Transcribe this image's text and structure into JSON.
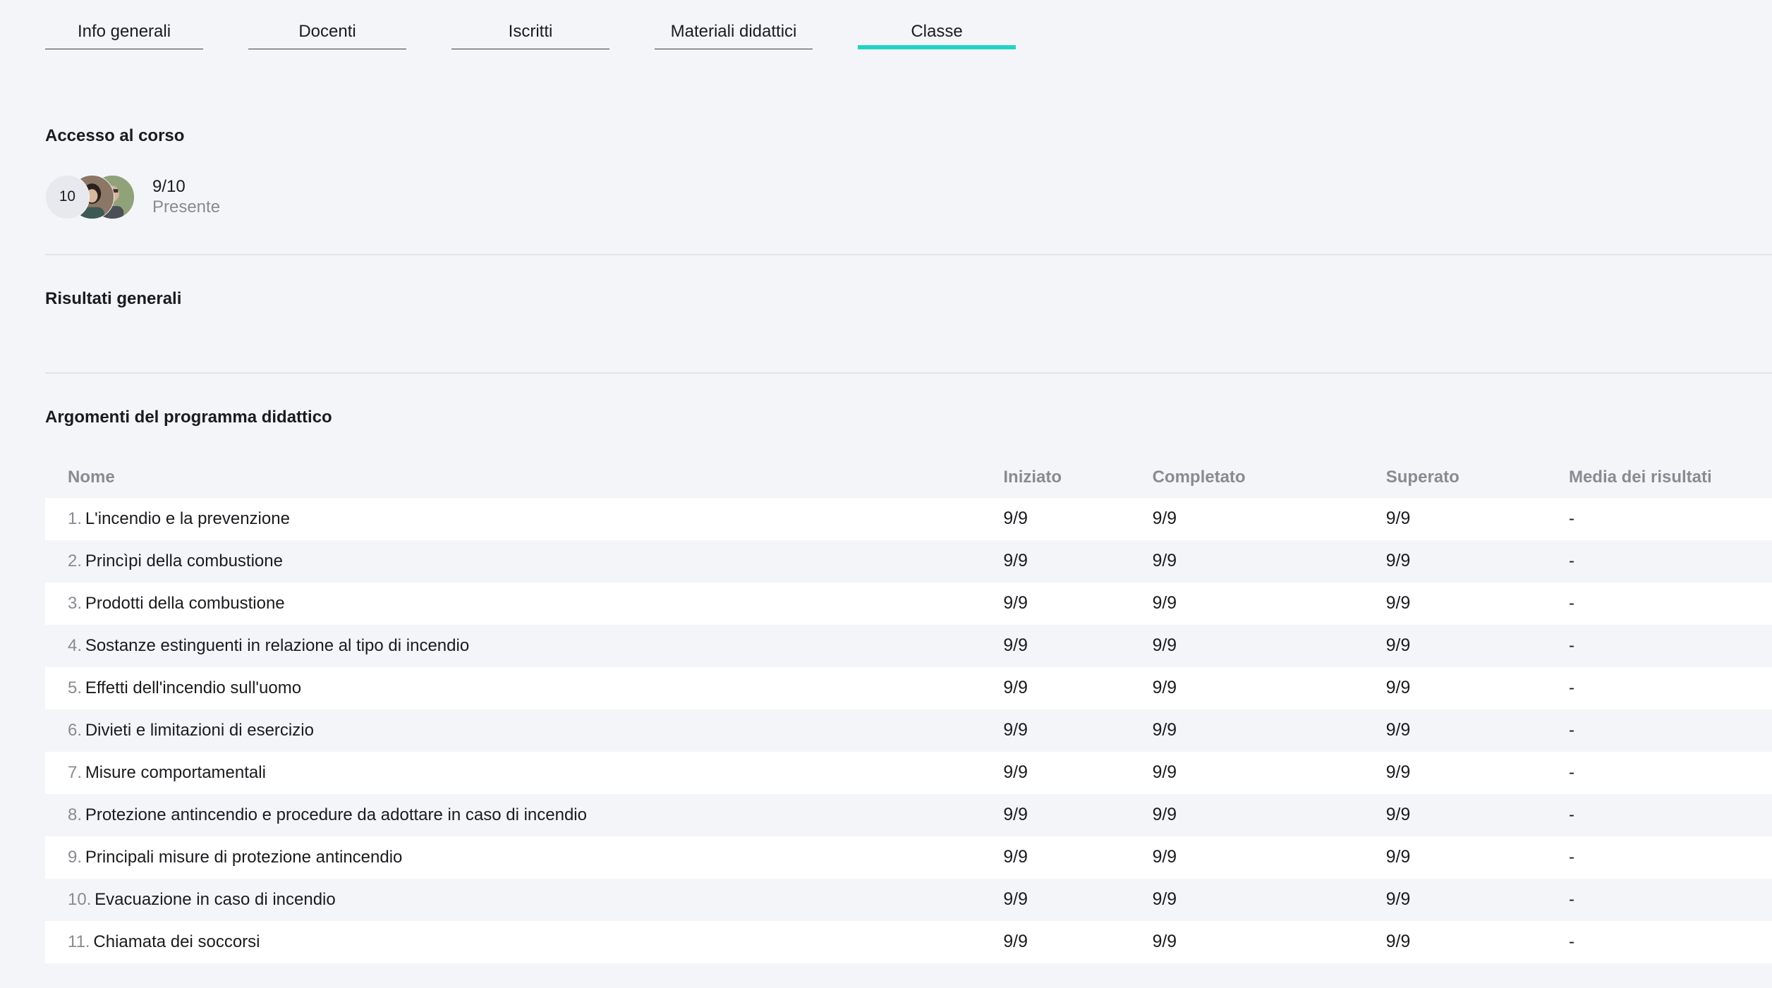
{
  "tabs": [
    {
      "label": "Info generali",
      "active": false
    },
    {
      "label": "Docenti",
      "active": false
    },
    {
      "label": "Iscritti",
      "active": false
    },
    {
      "label": "Materiali didattici",
      "active": false
    },
    {
      "label": "Classe",
      "active": true
    }
  ],
  "accent_color": "#22d3c5",
  "access": {
    "title": "Accesso al corso",
    "avatar_count": "10",
    "ratio": "9/10",
    "status": "Presente"
  },
  "results": {
    "title": "Risultati generali"
  },
  "topics": {
    "title": "Argomenti del programma didattico",
    "columns": {
      "name": "Nome",
      "started": "Iniziato",
      "completed": "Completato",
      "passed": "Superato",
      "average": "Media dei risultati"
    },
    "rows": [
      {
        "index": "1.",
        "name": "L'incendio e la prevenzione",
        "started": "9/9",
        "completed": "9/9",
        "passed": "9/9",
        "average": "-"
      },
      {
        "index": "2.",
        "name": "Princìpi della combustione",
        "started": "9/9",
        "completed": "9/9",
        "passed": "9/9",
        "average": "-"
      },
      {
        "index": "3.",
        "name": "Prodotti della combustione",
        "started": "9/9",
        "completed": "9/9",
        "passed": "9/9",
        "average": "-"
      },
      {
        "index": "4.",
        "name": "Sostanze estinguenti in relazione al tipo di incendio",
        "started": "9/9",
        "completed": "9/9",
        "passed": "9/9",
        "average": "-"
      },
      {
        "index": "5.",
        "name": "Effetti dell'incendio sull'uomo",
        "started": "9/9",
        "completed": "9/9",
        "passed": "9/9",
        "average": "-"
      },
      {
        "index": "6.",
        "name": "Divieti e limitazioni di esercizio",
        "started": "9/9",
        "completed": "9/9",
        "passed": "9/9",
        "average": "-"
      },
      {
        "index": "7.",
        "name": "Misure comportamentali",
        "started": "9/9",
        "completed": "9/9",
        "passed": "9/9",
        "average": "-"
      },
      {
        "index": "8.",
        "name": "Protezione antincendio e procedure da adottare in caso di incendio",
        "started": "9/9",
        "completed": "9/9",
        "passed": "9/9",
        "average": "-"
      },
      {
        "index": "9.",
        "name": "Principali misure di protezione antincendio",
        "started": "9/9",
        "completed": "9/9",
        "passed": "9/9",
        "average": "-"
      },
      {
        "index": "10.",
        "name": "Evacuazione in caso di incendio",
        "started": "9/9",
        "completed": "9/9",
        "passed": "9/9",
        "average": "-"
      },
      {
        "index": "11.",
        "name": "Chiamata dei soccorsi",
        "started": "9/9",
        "completed": "9/9",
        "passed": "9/9",
        "average": "-"
      }
    ]
  }
}
